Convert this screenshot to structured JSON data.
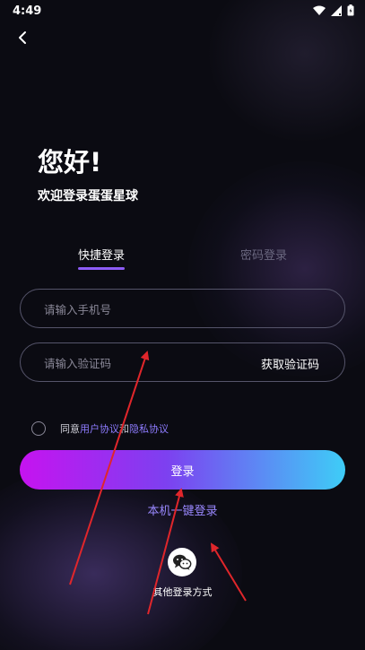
{
  "status_bar": {
    "time": "4:49"
  },
  "greeting": "您好!",
  "welcome": "欢迎登录蛋蛋星球",
  "tabs": {
    "quick": "快捷登录",
    "password": "密码登录"
  },
  "phone": {
    "placeholder": "请输入手机号",
    "value": ""
  },
  "code": {
    "placeholder": "请输入验证码",
    "value": "",
    "get_code_label": "获取验证码"
  },
  "agreement": {
    "prefix": "同意",
    "user_agreement": "用户协议",
    "and": "和",
    "privacy_policy": "隐私协议",
    "checked": false
  },
  "login_button": "登录",
  "one_key_login": "本机一键登录",
  "other_methods": {
    "label": "其他登录方式",
    "icon": "wechat-icon"
  },
  "colors": {
    "accent": "#8d5cf6",
    "link": "#8e7cff",
    "gradient_start": "#c613f0",
    "gradient_end": "#3ecdf7",
    "annotation": "#e0262b"
  }
}
